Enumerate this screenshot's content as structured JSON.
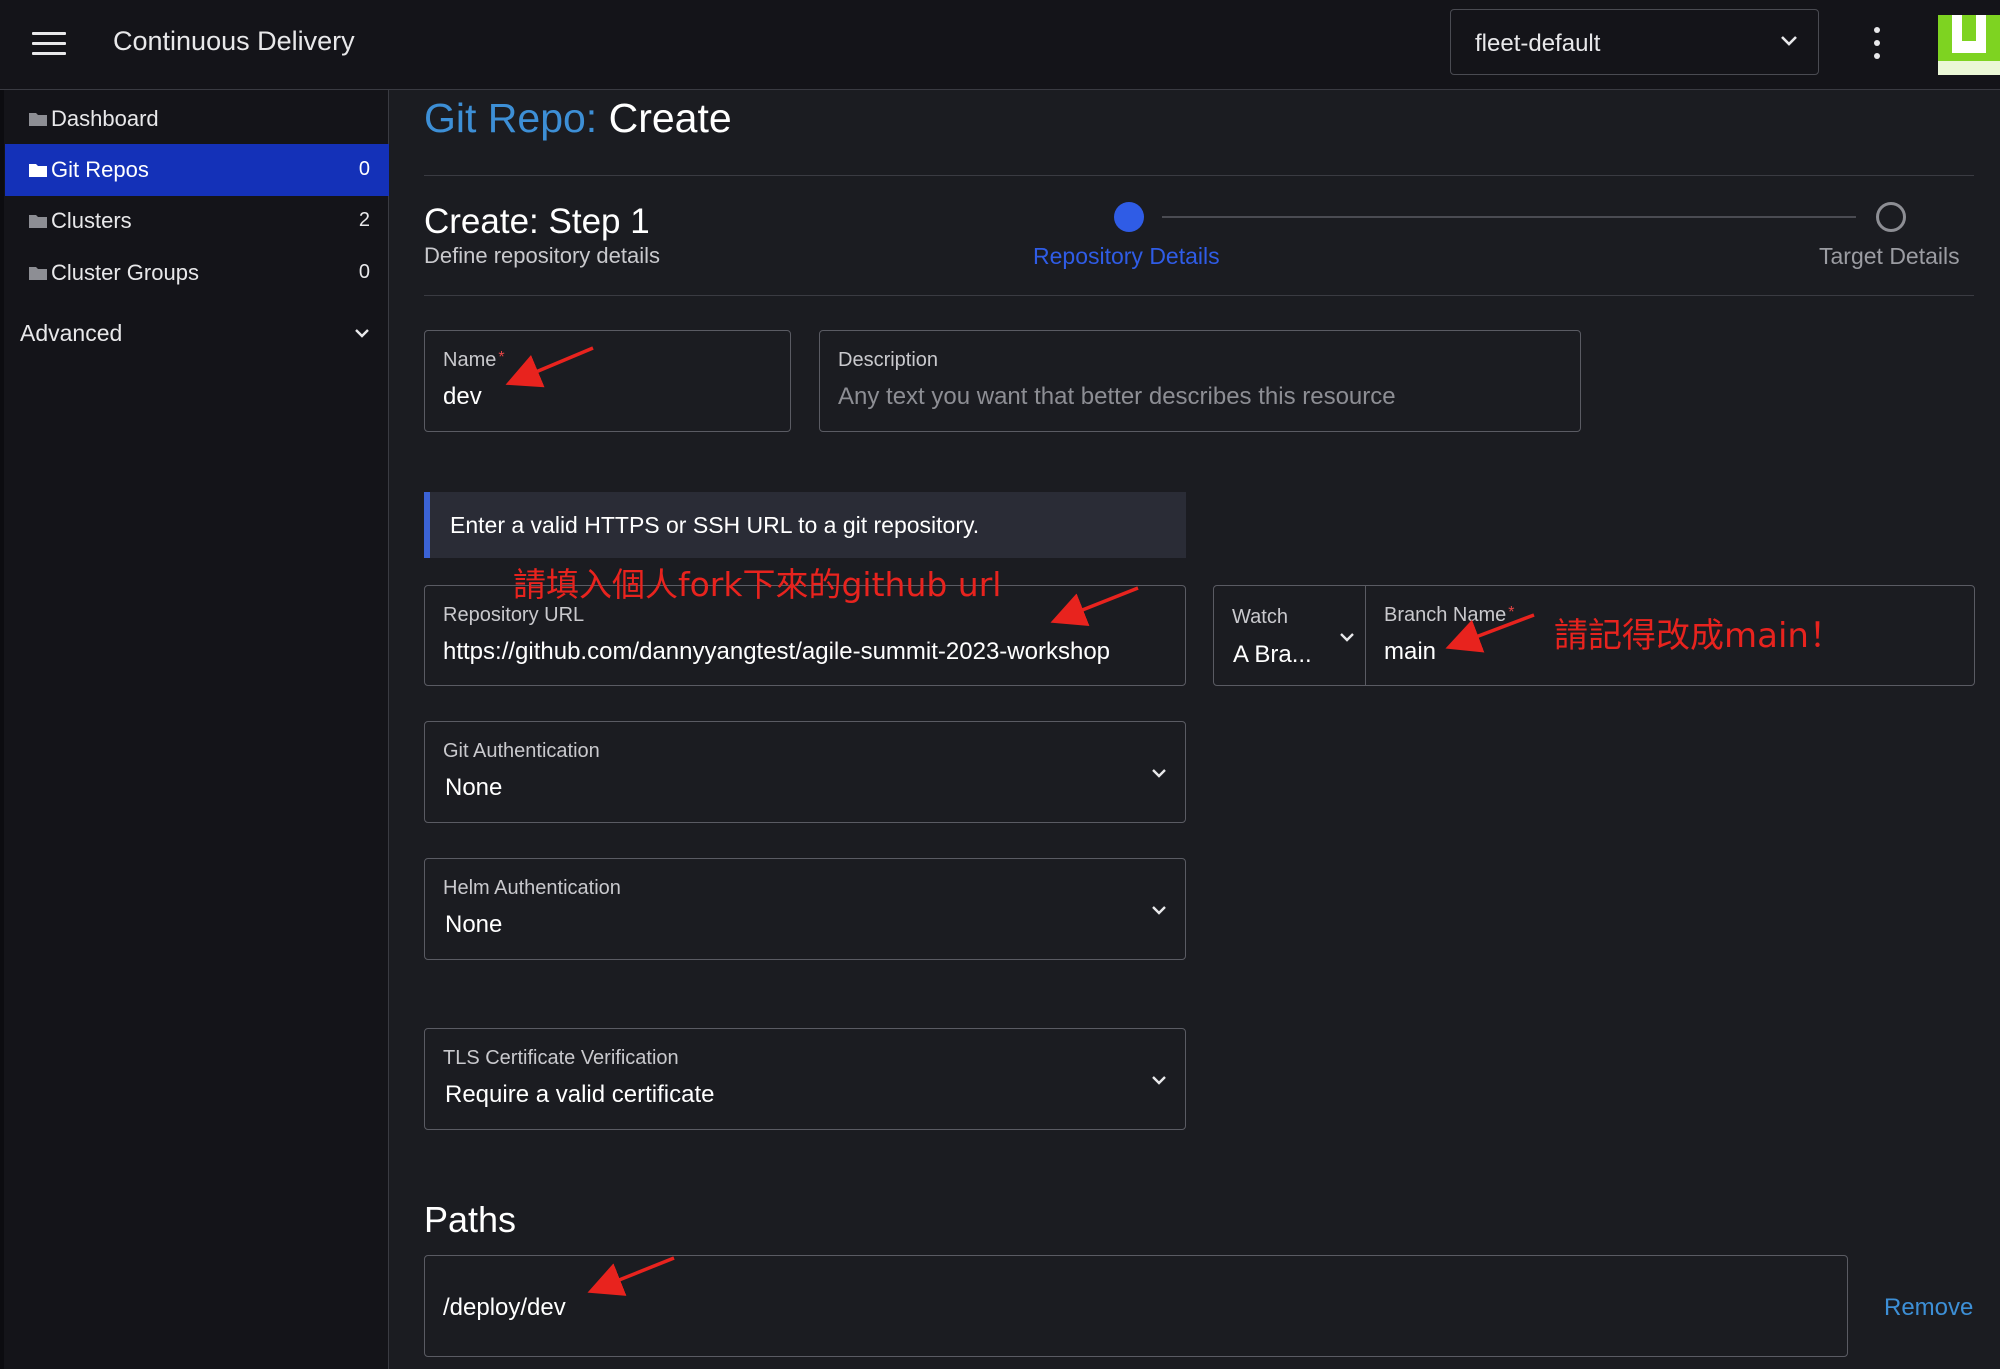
{
  "header": {
    "title": "Continuous Delivery",
    "namespace": "fleet-default"
  },
  "sidebar": {
    "items": [
      {
        "label": "Dashboard",
        "count": ""
      },
      {
        "label": "Git Repos",
        "count": "0"
      },
      {
        "label": "Clusters",
        "count": "2"
      },
      {
        "label": "Cluster Groups",
        "count": "0"
      }
    ],
    "group": {
      "label": "Advanced"
    }
  },
  "page": {
    "crumb_link": "Git Repo:",
    "crumb_current": "Create"
  },
  "wizard": {
    "title": "Create: Step 1",
    "subtitle": "Define repository details",
    "steps": [
      "Repository Details",
      "Target Details"
    ],
    "active_step": 1
  },
  "form": {
    "name": {
      "label": "Name",
      "required": "*",
      "value": "dev"
    },
    "description": {
      "label": "Description",
      "placeholder": "Any text you want that better describes this resource"
    },
    "banner": "Enter a valid HTTPS or SSH URL to a git repository.",
    "repo_url": {
      "label": "Repository URL",
      "value": "https://github.com/dannyyangtest/agile-summit-2023-workshop"
    },
    "watch": {
      "label": "Watch",
      "value": "A Bra..."
    },
    "branch": {
      "label": "Branch Name",
      "required": "*",
      "value": "main"
    },
    "git_auth": {
      "label": "Git Authentication",
      "value": "None"
    },
    "helm_auth": {
      "label": "Helm Authentication",
      "value": "None"
    },
    "tls": {
      "label": "TLS Certificate Verification",
      "value": "Require a valid certificate"
    },
    "paths": {
      "title": "Paths",
      "items": [
        {
          "value": "/deploy/dev",
          "remove_label": "Remove"
        }
      ]
    }
  },
  "annotations": {
    "repo_note": "請填入個人fork下來的github url",
    "branch_note": "請記得改成main！",
    "color": "#e8231e"
  },
  "colors": {
    "accent": "#2f5ce6",
    "active_nav": "#1431b8",
    "link": "#3d8fd6",
    "logo_green": "#7ed321"
  }
}
